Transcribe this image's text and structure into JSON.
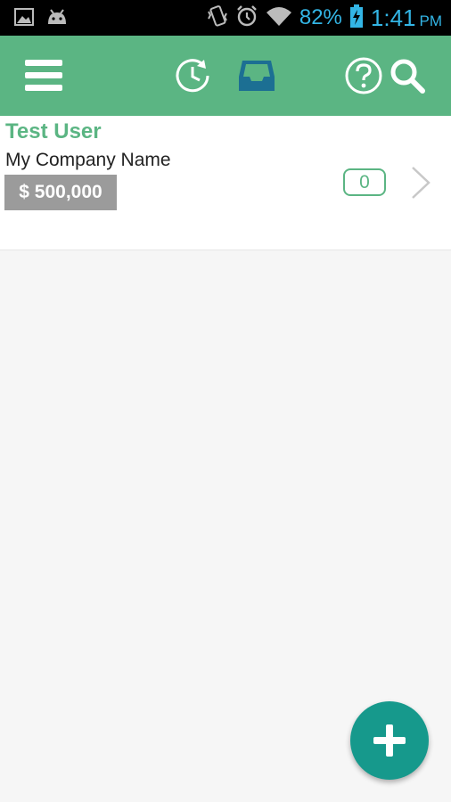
{
  "status_bar": {
    "battery_percent": "82%",
    "time": "1:41",
    "am_pm": "PM",
    "icons": [
      "image-icon",
      "android-icon",
      "vibrate-icon",
      "alarm-icon",
      "wifi-icon",
      "battery-charging-icon"
    ]
  },
  "app_bar": {
    "icons": [
      "menu-icon",
      "history-icon",
      "inbox-icon",
      "help-icon",
      "search-icon"
    ],
    "color": "#5bb583"
  },
  "contact": {
    "name": "Test User",
    "company": "My Company Name",
    "amount": "$ 500,000",
    "count": "0"
  },
  "fab": {
    "icon": "plus-icon",
    "color": "#16998c"
  },
  "colors": {
    "accent": "#5bb583",
    "status_text": "#33b5e5",
    "amount_bg": "#9b9b9b"
  }
}
